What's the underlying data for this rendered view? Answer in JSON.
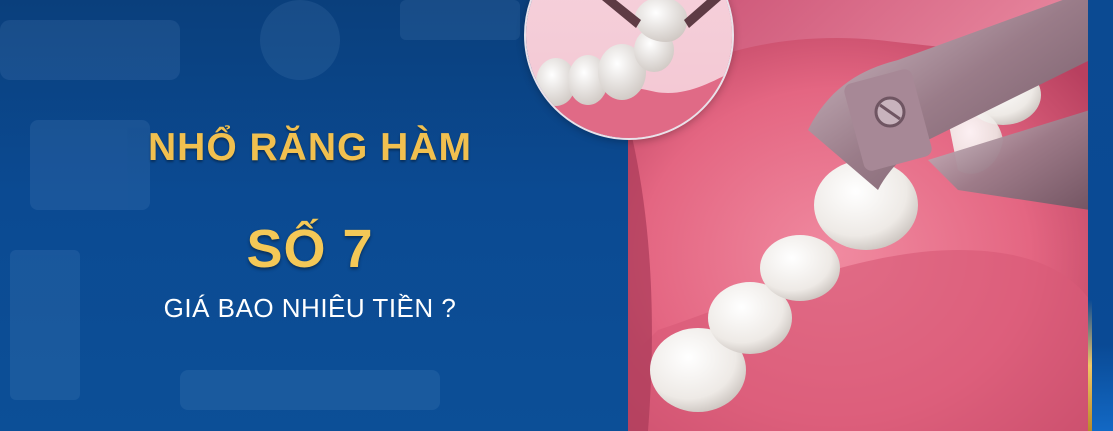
{
  "headline": {
    "line1": "NHỔ RĂNG HÀM",
    "line2": "SỐ 7",
    "line3": "GIÁ BAO NHIÊU TIỀN ?"
  },
  "colors": {
    "background": "#0b4a92",
    "headline_gold": "#f1c04f",
    "subtitle": "#ffffff",
    "gum_pink": "#e8728f"
  },
  "illustrations": {
    "main": "tooth-extraction-forceps-illustration",
    "inset": "molar-extraction-closeup-illustration"
  }
}
